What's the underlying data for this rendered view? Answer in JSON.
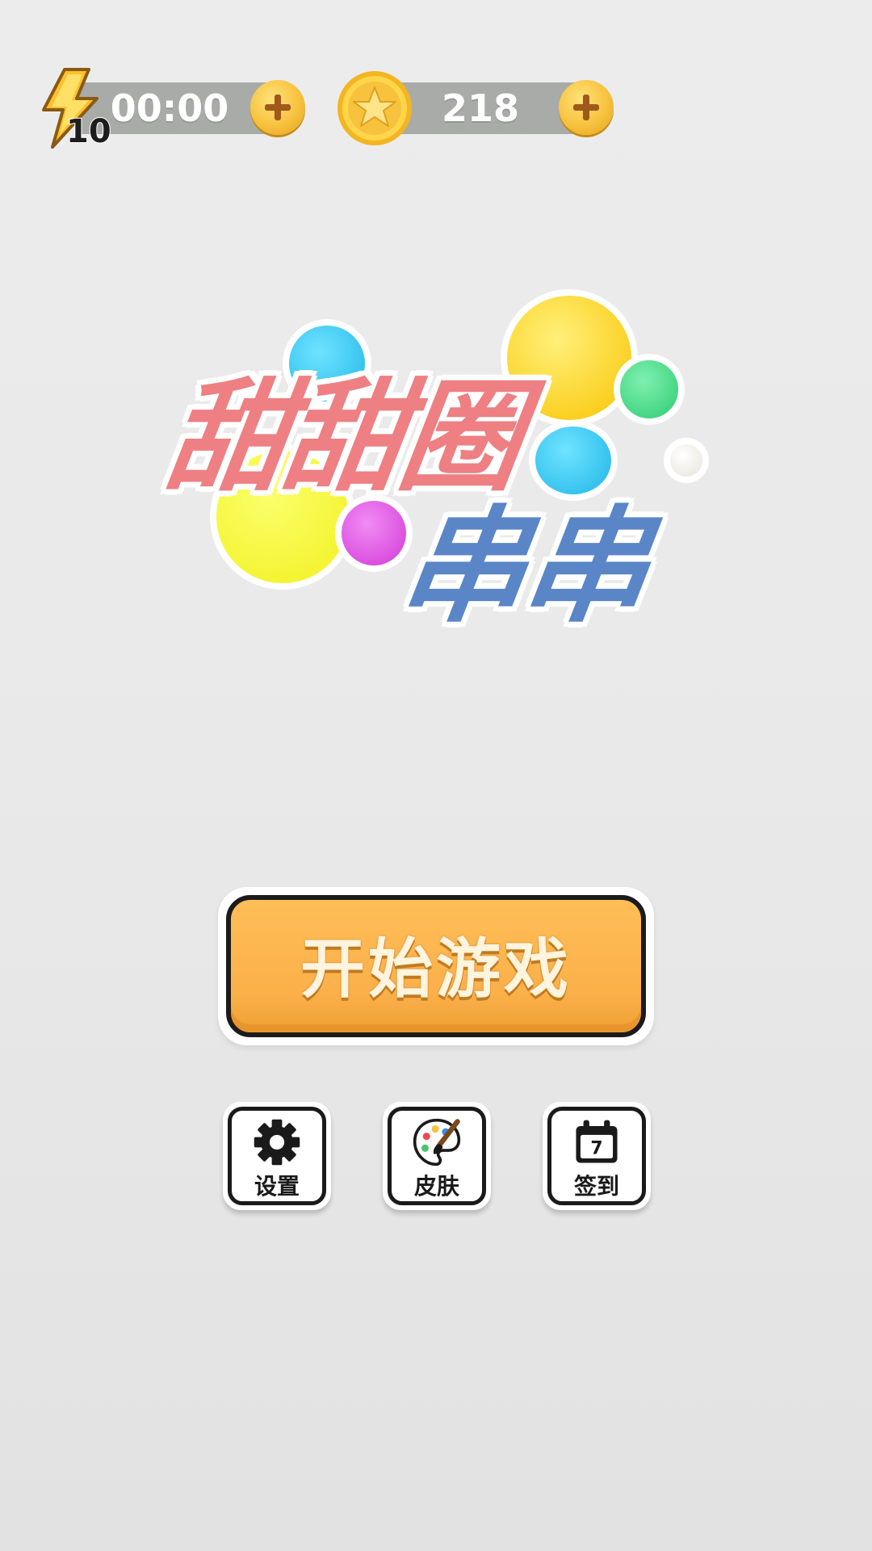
{
  "hud": {
    "energy_count": "10",
    "energy_timer": "00:00",
    "coins": "218"
  },
  "logo": {
    "line1": "甜甜圈",
    "line2": "串串"
  },
  "menu": {
    "start_label": "开始游戏",
    "settings_label": "设置",
    "skin_label": "皮肤",
    "checkin_label": "签到",
    "calendar_day": "7"
  },
  "colors": {
    "button_orange": "#fbb04a",
    "logo_pink": "#ee7f82",
    "logo_blue": "#5a86c8",
    "hud_pill": "#a9aba9",
    "coin_gold": "#f7c23e"
  },
  "icons": [
    "lightning-icon",
    "coin-icon",
    "plus-icon",
    "gear-icon",
    "palette-icon",
    "calendar-icon"
  ]
}
